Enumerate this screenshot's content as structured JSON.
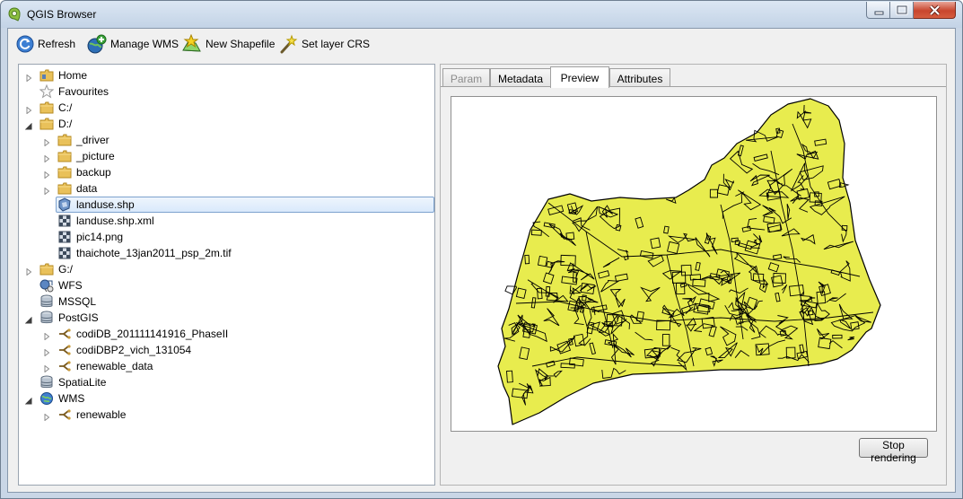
{
  "window": {
    "title": "QGIS Browser"
  },
  "toolbar": {
    "refresh": "Refresh",
    "manage_wms": "Manage WMS",
    "new_shapefile": "New Shapefile",
    "set_layer_crs": "Set layer CRS"
  },
  "tree": [
    {
      "label": "Home",
      "icon": "home-folder-icon",
      "depth": 0,
      "expander": "collapsed"
    },
    {
      "label": "Favourites",
      "icon": "star-icon",
      "depth": 0,
      "expander": "none"
    },
    {
      "label": "C:/",
      "icon": "folder-icon",
      "depth": 0,
      "expander": "collapsed"
    },
    {
      "label": "D:/",
      "icon": "folder-icon",
      "depth": 0,
      "expander": "expanded"
    },
    {
      "label": "_driver",
      "icon": "folder-icon",
      "depth": 1,
      "expander": "collapsed"
    },
    {
      "label": "_picture",
      "icon": "folder-icon",
      "depth": 1,
      "expander": "collapsed"
    },
    {
      "label": "backup",
      "icon": "folder-icon",
      "depth": 1,
      "expander": "collapsed"
    },
    {
      "label": "data",
      "icon": "folder-icon",
      "depth": 1,
      "expander": "collapsed"
    },
    {
      "label": "landuse.shp",
      "icon": "polygon-layer-icon",
      "depth": 1,
      "expander": "none",
      "selected": true
    },
    {
      "label": "landuse.shp.xml",
      "icon": "raster-layer-icon",
      "depth": 1,
      "expander": "none"
    },
    {
      "label": "pic14.png",
      "icon": "raster-layer-icon",
      "depth": 1,
      "expander": "none"
    },
    {
      "label": "thaichote_13jan2011_psp_2m.tif",
      "icon": "raster-layer-icon",
      "depth": 1,
      "expander": "none"
    },
    {
      "label": "G:/",
      "icon": "folder-icon",
      "depth": 0,
      "expander": "collapsed"
    },
    {
      "label": "WFS",
      "icon": "wfs-icon",
      "depth": 0,
      "expander": "none"
    },
    {
      "label": "MSSQL",
      "icon": "database-icon",
      "depth": 0,
      "expander": "none"
    },
    {
      "label": "PostGIS",
      "icon": "database-icon",
      "depth": 0,
      "expander": "expanded"
    },
    {
      "label": "codiDB_201111141916_PhaseII",
      "icon": "connection-icon",
      "depth": 1,
      "expander": "collapsed"
    },
    {
      "label": "codiDBP2_vich_131054",
      "icon": "connection-icon",
      "depth": 1,
      "expander": "collapsed"
    },
    {
      "label": "renewable_data",
      "icon": "connection-icon",
      "depth": 1,
      "expander": "collapsed"
    },
    {
      "label": "SpatiaLite",
      "icon": "database-icon",
      "depth": 0,
      "expander": "none"
    },
    {
      "label": "WMS",
      "icon": "globe-icon",
      "depth": 0,
      "expander": "expanded"
    },
    {
      "label": "renewable",
      "icon": "connection-icon",
      "depth": 1,
      "expander": "collapsed"
    }
  ],
  "tabs": [
    {
      "label": "Param",
      "state": "disabled"
    },
    {
      "label": "Metadata",
      "state": "normal"
    },
    {
      "label": "Preview",
      "state": "active"
    },
    {
      "label": "Attributes",
      "state": "normal"
    }
  ],
  "preview": {
    "fill_color": "#e8ec4e",
    "outline_color": "#000000",
    "stop_button": "Stop rendering"
  }
}
